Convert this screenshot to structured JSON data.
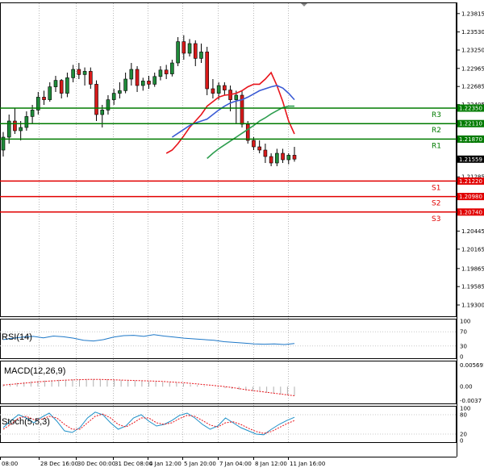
{
  "chart_data": [
    {
      "type": "candlestick",
      "price_axis": {
        "ticks": [
          "1.23815",
          "1.23530",
          "1.23250",
          "1.22965",
          "1.22685",
          "1.22405",
          "1.22125",
          "1.21845",
          "1.21565",
          "1.21285",
          "1.21005",
          "1.20725",
          "1.20445",
          "1.20165",
          "1.19865",
          "1.19585",
          "1.19300"
        ],
        "ylim": [
          1.1915,
          1.2395
        ]
      },
      "x_axis": {
        "ticks": [
          "08:00",
          "28 Dec 16:00",
          "30 Dec 00:00",
          "31 Dec 08:00",
          "4 Jan 12:00",
          "5 Jan 20:00",
          "7 Jan 04:00",
          "8 Jan 12:00",
          "11 Jan 16:00"
        ]
      },
      "candles": [
        [
          1.217,
          1.2198,
          1.216,
          1.219
        ],
        [
          1.219,
          1.2225,
          1.218,
          1.2215
        ],
        [
          1.2215,
          1.2235,
          1.2195,
          1.22
        ],
        [
          1.22,
          1.2215,
          1.2185,
          1.2205
        ],
        [
          1.2205,
          1.223,
          1.22,
          1.2222
        ],
        [
          1.2222,
          1.224,
          1.221,
          1.2232
        ],
        [
          1.2232,
          1.226,
          1.2225,
          1.2252
        ],
        [
          1.2252,
          1.2262,
          1.224,
          1.2248
        ],
        [
          1.2248,
          1.2275,
          1.2245,
          1.2268
        ],
        [
          1.2268,
          1.2285,
          1.226,
          1.2278
        ],
        [
          1.2278,
          1.228,
          1.225,
          1.2258
        ],
        [
          1.2258,
          1.229,
          1.2252,
          1.2282
        ],
        [
          1.2282,
          1.2302,
          1.2275,
          1.2295
        ],
        [
          1.2295,
          1.2305,
          1.228,
          1.2287
        ],
        [
          1.2287,
          1.2298,
          1.227,
          1.2292
        ],
        [
          1.2292,
          1.2298,
          1.2265,
          1.2272
        ],
        [
          1.2272,
          1.2278,
          1.2215,
          1.2225
        ],
        [
          1.2225,
          1.224,
          1.2205,
          1.2232
        ],
        [
          1.2232,
          1.2255,
          1.2225,
          1.2248
        ],
        [
          1.2248,
          1.2265,
          1.224,
          1.2258
        ],
        [
          1.2258,
          1.2275,
          1.225,
          1.2262
        ],
        [
          1.2262,
          1.229,
          1.2258,
          1.228
        ],
        [
          1.228,
          1.2305,
          1.227,
          1.2295
        ],
        [
          1.2295,
          1.23,
          1.226,
          1.227
        ],
        [
          1.227,
          1.2282,
          1.2262,
          1.2277
        ],
        [
          1.2277,
          1.2285,
          1.2265,
          1.2272
        ],
        [
          1.2272,
          1.229,
          1.2268,
          1.2284
        ],
        [
          1.2284,
          1.23,
          1.2278,
          1.2294
        ],
        [
          1.2294,
          1.2302,
          1.228,
          1.2288
        ],
        [
          1.2288,
          1.231,
          1.2284,
          1.2305
        ],
        [
          1.2305,
          1.2345,
          1.23,
          1.2338
        ],
        [
          1.2338,
          1.2348,
          1.231,
          1.232
        ],
        [
          1.232,
          1.2342,
          1.2315,
          1.2335
        ],
        [
          1.2335,
          1.234,
          1.23,
          1.2312
        ],
        [
          1.2312,
          1.2335,
          1.2305,
          1.2322
        ],
        [
          1.2322,
          1.233,
          1.2255,
          1.2265
        ],
        [
          1.2265,
          1.228,
          1.225,
          1.2258
        ],
        [
          1.2258,
          1.2275,
          1.2248,
          1.227
        ],
        [
          1.227,
          1.2275,
          1.2255,
          1.2263
        ],
        [
          1.2263,
          1.227,
          1.223,
          1.2248
        ],
        [
          1.2248,
          1.2262,
          1.221,
          1.2255
        ],
        [
          1.2255,
          1.2262,
          1.2205,
          1.221
        ],
        [
          1.221,
          1.2215,
          1.218,
          1.2185
        ],
        [
          1.2185,
          1.219,
          1.217,
          1.2175
        ],
        [
          1.2175,
          1.2185,
          1.2165,
          1.217
        ],
        [
          1.217,
          1.218,
          1.215,
          1.216
        ],
        [
          1.216,
          1.2165,
          1.2145,
          1.215
        ],
        [
          1.215,
          1.2172,
          1.2145,
          1.2165
        ],
        [
          1.2165,
          1.2172,
          1.215,
          1.2155
        ],
        [
          1.2155,
          1.2165,
          1.2148,
          1.2162
        ],
        [
          1.2162,
          1.2175,
          1.2152,
          1.2156
        ]
      ],
      "moving_averages": [
        {
          "color": "#e8141b",
          "values": [
            1.2165,
            1.217,
            1.218,
            1.2192,
            1.2205,
            1.2215,
            1.2225,
            1.2238,
            1.2245,
            1.2252,
            1.2255,
            1.2256,
            1.2258,
            1.2262,
            1.2268,
            1.2272,
            1.2272,
            1.228,
            1.229,
            1.227,
            1.2245,
            1.2215,
            1.2195
          ]
        },
        {
          "color": "#3b5bd5",
          "values": [
            1.219,
            1.2196,
            1.2202,
            1.2208,
            1.2212,
            1.2215,
            1.2218,
            1.2225,
            1.2232,
            1.2238,
            1.2243,
            1.2246,
            1.2248,
            1.2252,
            1.2257,
            1.2262,
            1.2265,
            1.2268,
            1.227,
            1.2266,
            1.2258,
            1.2248
          ]
        },
        {
          "color": "#2e9e4f",
          "values": [
            1.2157,
            1.2165,
            1.2172,
            1.2178,
            1.2184,
            1.219,
            1.2196,
            1.2202,
            1.2208,
            1.2215,
            1.222,
            1.2226,
            1.2231,
            1.2236,
            1.2238,
            1.2238
          ]
        }
      ],
      "levels": [
        {
          "name": "R3",
          "value": "1.22350",
          "color": "#007b00"
        },
        {
          "name": "R2",
          "value": "1.22110",
          "color": "#007b00"
        },
        {
          "name": "R1",
          "value": "1.21870",
          "color": "#007b00"
        },
        {
          "name": "S1",
          "value": "1.21220",
          "color": "#e10000"
        },
        {
          "name": "S2",
          "value": "1.20980",
          "color": "#e10000"
        },
        {
          "name": "S3",
          "value": "1.20740",
          "color": "#e10000"
        }
      ],
      "current_price": "1.21559"
    },
    {
      "type": "line",
      "title": "RSI(14)",
      "ticks": [
        "100",
        "70",
        "30",
        "0"
      ],
      "ylim": [
        0,
        100
      ],
      "series": [
        {
          "color": "#1e78c8",
          "values": [
            48,
            52,
            55,
            57,
            53,
            58,
            56,
            52,
            46,
            44,
            48,
            55,
            59,
            60,
            57,
            62,
            58,
            55,
            52,
            50,
            48,
            46,
            42,
            40,
            38,
            36,
            35,
            36,
            34,
            37
          ]
        }
      ]
    },
    {
      "type": "histogram",
      "title": "MACD(12,26,9)",
      "ticks": [
        "0.005691",
        "0.00",
        "-0.0037"
      ],
      "ylim": [
        -0.0042,
        0.0062
      ],
      "histogram": [
        0.0006,
        0.0008,
        0.001,
        0.0012,
        0.0014,
        0.0015,
        0.0016,
        0.0017,
        0.0018,
        0.0018,
        0.0019,
        0.0019,
        0.002,
        0.002,
        0.0019,
        0.0019,
        0.0018,
        0.0017,
        0.0017,
        0.0016,
        0.0015,
        0.0014,
        0.0013,
        0.0012,
        0.0011,
        0.001,
        0.0008,
        0.0006,
        0.0004,
        0.0002,
        0.0,
        -0.0002,
        -0.0004,
        -0.0006,
        -0.0008,
        -0.001,
        -0.0012,
        -0.0014,
        -0.0016,
        -0.0018,
        -0.002,
        -0.0022,
        -0.0024
      ],
      "signal": {
        "color": "#e8141b",
        "values": [
          0.0004,
          0.0007,
          0.001,
          0.0013,
          0.0015,
          0.0017,
          0.0018,
          0.0019,
          0.0019,
          0.0018,
          0.0017,
          0.0016,
          0.0015,
          0.0014,
          0.0012,
          0.001,
          0.0007,
          0.0004,
          0.0001,
          -0.0003,
          -0.0008,
          -0.0012,
          -0.0016,
          -0.002,
          -0.0024
        ]
      }
    },
    {
      "type": "line",
      "title": "Stoch(5,5,3)",
      "ticks": [
        "100",
        "80",
        "20",
        "0"
      ],
      "ylim": [
        0,
        100
      ],
      "series": [
        {
          "color": "#1e90c8",
          "values": [
            40,
            62,
            80,
            70,
            55,
            72,
            85,
            60,
            30,
            25,
            40,
            70,
            88,
            80,
            55,
            35,
            45,
            70,
            80,
            60,
            45,
            50,
            62,
            78,
            85,
            70,
            50,
            35,
            45,
            70,
            55,
            40,
            30,
            20,
            18,
            35,
            50,
            62,
            72
          ]
        },
        {
          "color": "#e8141b",
          "values": [
            35,
            50,
            70,
            75,
            65,
            66,
            75,
            70,
            50,
            35,
            35,
            55,
            75,
            82,
            70,
            50,
            42,
            55,
            70,
            70,
            55,
            50,
            55,
            68,
            78,
            75,
            62,
            48,
            42,
            55,
            58,
            50,
            38,
            28,
            22,
            28,
            40,
            52,
            62
          ]
        }
      ]
    }
  ]
}
